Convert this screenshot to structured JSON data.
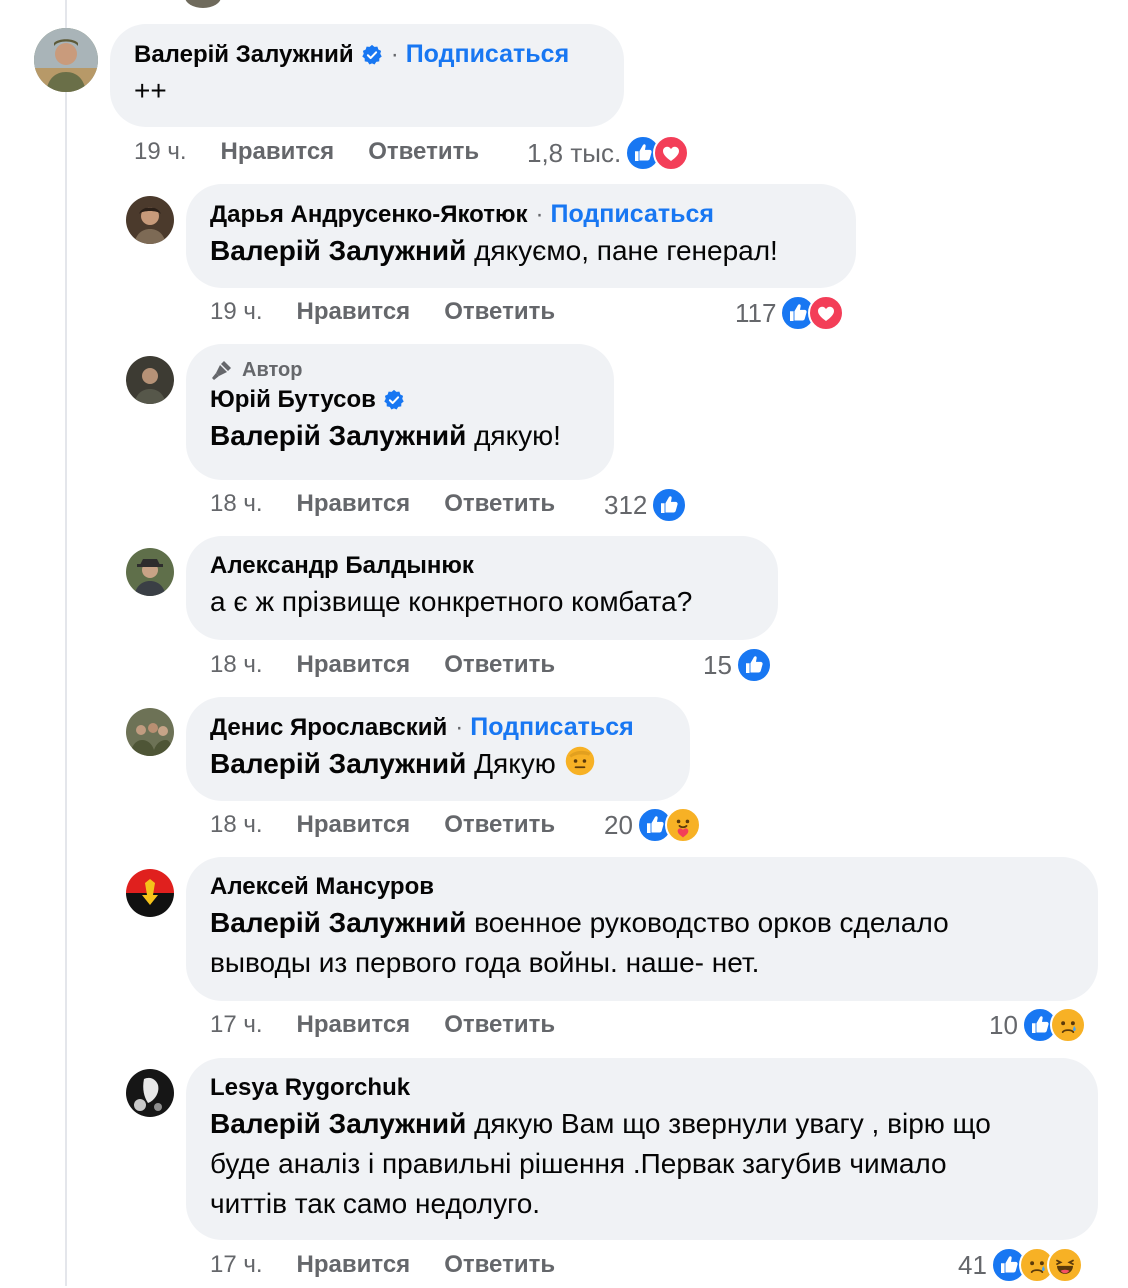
{
  "colors": {
    "accent": "#1877f2",
    "bubble": "#f0f2f5",
    "muted": "#65676b",
    "love": "#f33e58",
    "emoji": "#f7b125"
  },
  "comments": [
    {
      "name": "Валерій Залужний",
      "verified": true,
      "follow": "Подписаться",
      "text": "++",
      "time": "19 ч.",
      "like": "Нравится",
      "reply": "Ответить",
      "reactions_count": "1,8 тыс.",
      "reactions": [
        "like-icon",
        "love-icon"
      ]
    },
    {
      "name": "Дарья Андрусенко-Якотюк",
      "follow": "Подписаться",
      "mention": "Валерій Залужний",
      "text": " дякуємо, пане генерал!",
      "time": "19 ч.",
      "like": "Нравится",
      "reply": "Ответить",
      "reactions_count": "117",
      "reactions": [
        "like-icon",
        "love-icon"
      ]
    },
    {
      "author_badge": "Автор",
      "name": "Юрій Бутусов",
      "verified": true,
      "mention": "Валерій Залужний",
      "text": " дякую!",
      "time": "18 ч.",
      "like": "Нравится",
      "reply": "Ответить",
      "reactions_count": "312",
      "reactions": [
        "like-icon"
      ]
    },
    {
      "name": "Александр Балдынюк",
      "text": "а є ж прізвище конкретного комбата?",
      "time": "18 ч.",
      "like": "Нравится",
      "reply": "Ответить",
      "reactions_count": "15",
      "reactions": [
        "like-icon"
      ]
    },
    {
      "name": "Денис Ярославский",
      "follow": "Подписаться",
      "mention": "Валерій Залужний",
      "text": " Дякую",
      "emoji": "saluting-face-icon",
      "time": "18 ч.",
      "like": "Нравится",
      "reply": "Ответить",
      "reactions_count": "20",
      "reactions": [
        "like-icon",
        "care-icon"
      ]
    },
    {
      "name": "Алексей Мансуров",
      "mention": "Валерій Залужний",
      "text_line1": " военное руководство орков сделало",
      "text_line2": "выводы из первого года войны. наше- нет.",
      "time": "17 ч.",
      "like": "Нравится",
      "reply": "Ответить",
      "reactions_count": "10",
      "reactions": [
        "like-icon",
        "sad-icon"
      ]
    },
    {
      "name": "Lesya Rygorchuk",
      "mention": "Валерій Залужний",
      "text_line1": " дякую Вам що звернули увагу , вірю що",
      "text_line2": "буде аналіз і правильні рішення .Первак загубив чимало",
      "text_line3": "читтів так само недолуго.",
      "time": "17 ч.",
      "like": "Нравится",
      "reply": "Ответить",
      "reactions_count": "41",
      "reactions": [
        "like-icon",
        "sad-icon",
        "haha-icon"
      ]
    }
  ]
}
